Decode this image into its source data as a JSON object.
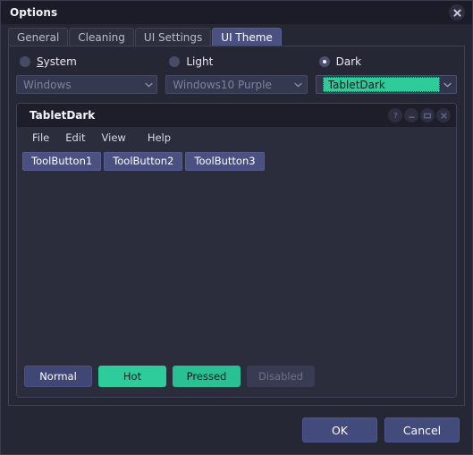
{
  "window": {
    "title": "Options",
    "close_icon": "close-circle-icon"
  },
  "tabs": [
    {
      "label": "General",
      "active": false
    },
    {
      "label": "Cleaning",
      "active": false
    },
    {
      "label": "UI Settings",
      "active": false
    },
    {
      "label": "UI Theme",
      "active": true
    }
  ],
  "theme_options": [
    {
      "radio_label": "System",
      "mnemonic": "S",
      "rest": "ystem",
      "selected": false,
      "combo_value": "Windows",
      "combo_enabled": false
    },
    {
      "radio_label": "Light",
      "mnemonic": "",
      "rest": "Light",
      "selected": false,
      "combo_value": "Windows10 Purple",
      "combo_enabled": false
    },
    {
      "radio_label": "Dark",
      "mnemonic": "",
      "rest": "Dark",
      "selected": true,
      "combo_value": "TabletDark",
      "combo_enabled": true
    }
  ],
  "preview": {
    "title": "TabletDark",
    "caption_buttons": [
      {
        "name": "help-button",
        "glyph": "?"
      },
      {
        "name": "minimize-button",
        "glyph": "–"
      },
      {
        "name": "maximize-button",
        "glyph": "▭"
      },
      {
        "name": "close-button",
        "glyph": "✕"
      }
    ],
    "menus": [
      "File",
      "Edit",
      "View",
      "Help"
    ],
    "toolbuttons": [
      "ToolButton1",
      "ToolButton2",
      "ToolButton3"
    ],
    "state_buttons": [
      {
        "label": "Normal",
        "state": "normal"
      },
      {
        "label": "Hot",
        "state": "hot"
      },
      {
        "label": "Pressed",
        "state": "pressed"
      },
      {
        "label": "Disabled",
        "state": "disabled"
      }
    ]
  },
  "footer": {
    "ok": "OK",
    "cancel": "Cancel"
  },
  "colors": {
    "accent_teal": "#2ecc9a",
    "accent_blue": "#4a5080",
    "dialog_bg": "#262735",
    "titlebar_bg": "#1b1c27",
    "preview_bg": "#2b2d3d"
  }
}
